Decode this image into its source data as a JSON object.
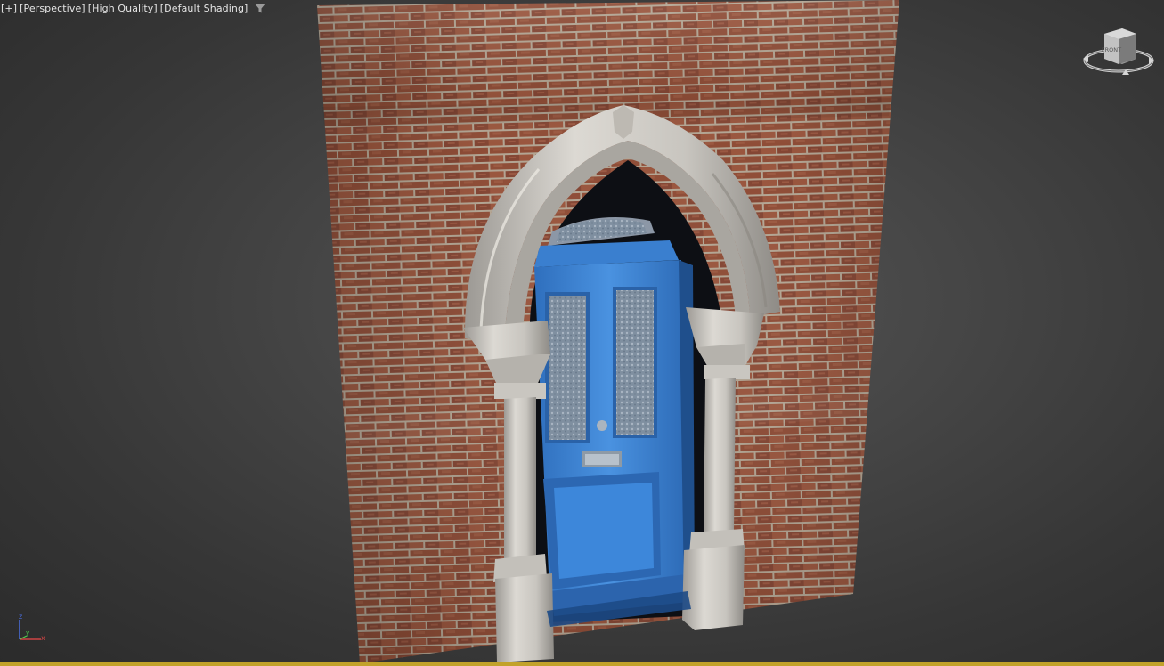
{
  "viewport": {
    "labels": [
      "[+]",
      "[Perspective]",
      "[High Quality]",
      "[Default Shading]"
    ],
    "filter_icon": "funnel-icon"
  },
  "viewcube": {
    "face_label": "FRONT",
    "icon": "viewcube-icon"
  },
  "axis": {
    "x": "x",
    "y": "y",
    "z": "z",
    "icon": "axis-tripod-icon"
  },
  "colors": {
    "background": "#444444",
    "brick": "#8a4a34",
    "mortar": "#b8aa98",
    "stone": "#cfccc6",
    "door": "#3f86d6",
    "selection_bar": "#c2a22a"
  }
}
